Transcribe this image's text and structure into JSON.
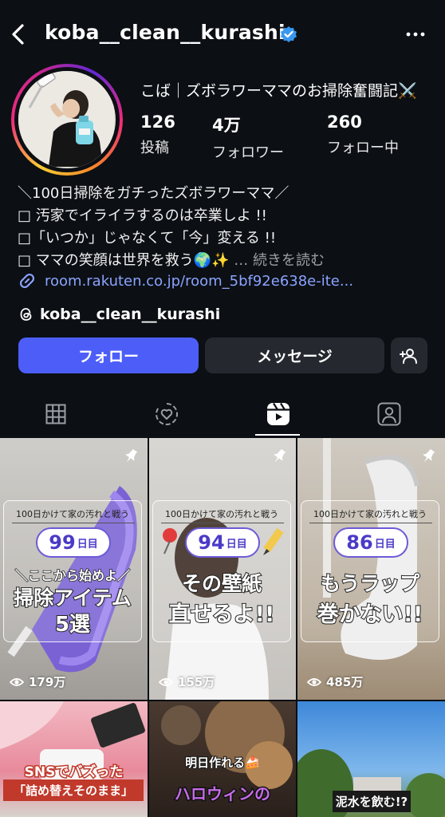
{
  "header": {
    "username": "koba__clean__kurashi"
  },
  "profile": {
    "display_name": "こば｜ズボラワーママのお掃除奮闘記⚔️",
    "stats": [
      {
        "value": "126",
        "label": "投稿"
      },
      {
        "value": "4万",
        "label": "フォロワー"
      },
      {
        "value": "260",
        "label": "フォロー中"
      }
    ],
    "bio": [
      "＼100日掃除をガチったズボラワーママ／",
      "□ 汚家でイライラするのは卒業しよ !!",
      "□「いつか」じゃなくて「今」変える !!",
      "□ ママの笑顔は世界を救う🌍✨"
    ],
    "read_more": "… 続きを読む",
    "link": "room.rakuten.co.jp/room_5bf92e638e-ite...",
    "threads": "koba__clean__kurashi"
  },
  "actions": {
    "follow": "フォロー",
    "message": "メッセージ"
  },
  "tabs": [
    "posts",
    "reels-liked",
    "reels",
    "tagged"
  ],
  "reels": [
    {
      "caption": "100日かけて家の汚れと戦う",
      "day": "99",
      "day_unit": "日目",
      "line1": "＼ここから始めよ／",
      "line2": "掃除アイテム",
      "line3": "5選",
      "views": "179万"
    },
    {
      "caption": "100日かけて家の汚れと戦う",
      "day": "94",
      "day_unit": "日目",
      "line1": "その壁紙",
      "line2": "直せるよ!!",
      "views": "155万"
    },
    {
      "caption": "100日かけて家の汚れと戦う",
      "day": "86",
      "day_unit": "日目",
      "line1": "もうラップ",
      "line2": "巻かない!!",
      "views": "485万"
    }
  ],
  "row2": [
    {
      "line1": "SNSでバズった",
      "line2": "「詰め替えそのまま」"
    },
    {
      "line1": "明日作れる🍰",
      "line2": "ハロウィンの"
    },
    {
      "line1": "泥水を飲む!?"
    }
  ],
  "colors": {
    "accent": "#4d5ef8",
    "link": "#8aa4ff",
    "verified": "#3897f0"
  }
}
